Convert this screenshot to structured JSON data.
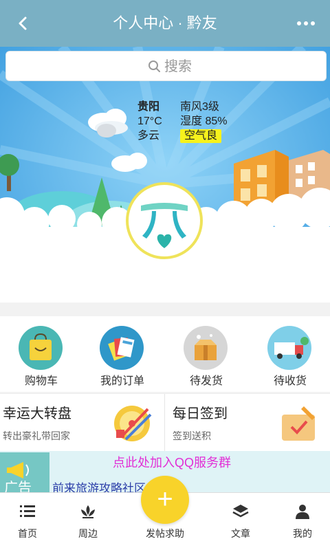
{
  "header": {
    "title": "个人中心 · 黔友",
    "back_icon": "back-arrow-icon",
    "more_icon": "more-dots-icon"
  },
  "search": {
    "placeholder": "搜索",
    "icon": "search-icon"
  },
  "weather": {
    "city": "贵阳",
    "wind": "南风3级",
    "temperature": "17°C",
    "humidity": "湿度 85%",
    "condition": "多云",
    "air_quality": "空气良"
  },
  "quick_actions": [
    {
      "label": "购物车",
      "icon": "shopping-bag-icon",
      "color": "#4ab7b4"
    },
    {
      "label": "我的订单",
      "icon": "order-cards-icon",
      "color": "#2f97c9"
    },
    {
      "label": "待发货",
      "icon": "package-box-icon",
      "color": "#d6d6d6"
    },
    {
      "label": "待收货",
      "icon": "delivery-truck-icon",
      "color": "#7fcfe8"
    }
  ],
  "cards": [
    {
      "title": "幸运大转盘",
      "subtitle": "转出豪礼带回家",
      "icon": "prize-wheel-icon"
    },
    {
      "title": "每日签到",
      "subtitle": "签到送积",
      "icon": "sign-in-pencil-icon"
    }
  ],
  "ad": {
    "title": "点此处加入QQ服务群",
    "subtitle": "前来旅游攻略社区 攻略",
    "icon_text": "广告"
  },
  "tabs": [
    {
      "label": "首页",
      "icon": "list-icon"
    },
    {
      "label": "周边",
      "icon": "lotus-icon"
    },
    {
      "label": "发帖求助",
      "icon": "plus-icon"
    },
    {
      "label": "文章",
      "icon": "layers-icon"
    },
    {
      "label": "我的",
      "icon": "person-icon"
    }
  ],
  "colors": {
    "header": "#7ab0c4",
    "fab": "#f8d32a",
    "ad_title": "#e12fd6"
  }
}
